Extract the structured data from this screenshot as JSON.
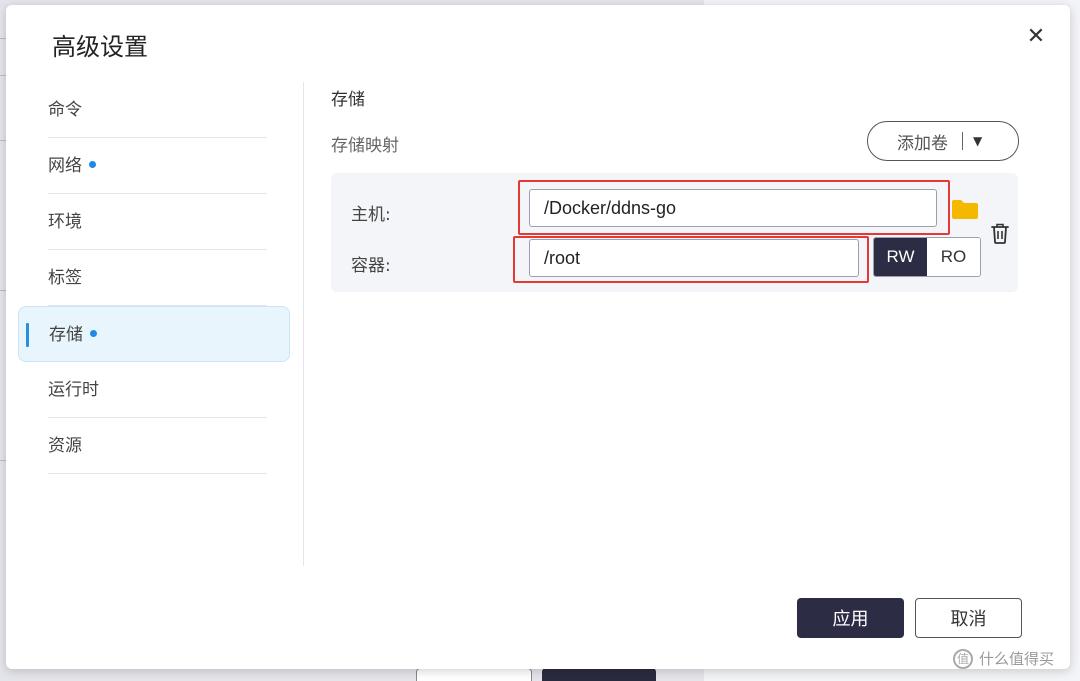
{
  "dialog": {
    "title": "高级设置",
    "close_icon": "close-icon"
  },
  "sidebar": {
    "items": [
      {
        "label": "命令",
        "dot": false
      },
      {
        "label": "网络",
        "dot": true
      },
      {
        "label": "环境",
        "dot": false
      },
      {
        "label": "标签",
        "dot": false
      },
      {
        "label": "存储",
        "dot": true,
        "active": true
      },
      {
        "label": "运行时",
        "dot": false
      },
      {
        "label": "资源",
        "dot": false
      }
    ]
  },
  "storage": {
    "section_title": "存储",
    "mapping_label": "存储映射",
    "add_volume_label": "添加卷",
    "host_label": "主机:",
    "host_value": "/Docker/ddns-go",
    "container_label": "容器:",
    "container_value": "/root",
    "mode_options": [
      "RW",
      "RO"
    ],
    "mode_selected": "RW"
  },
  "footer": {
    "apply_label": "应用",
    "cancel_label": "取消"
  },
  "watermark": {
    "text": "什么值得买",
    "icon_glyph": "值"
  },
  "colors": {
    "accent_dark": "#2c2c44",
    "active_bg": "#e8f5fd",
    "dot_blue": "#1f8ae6",
    "highlight_red": "#e53935",
    "folder_yellow": "#f5b800"
  }
}
